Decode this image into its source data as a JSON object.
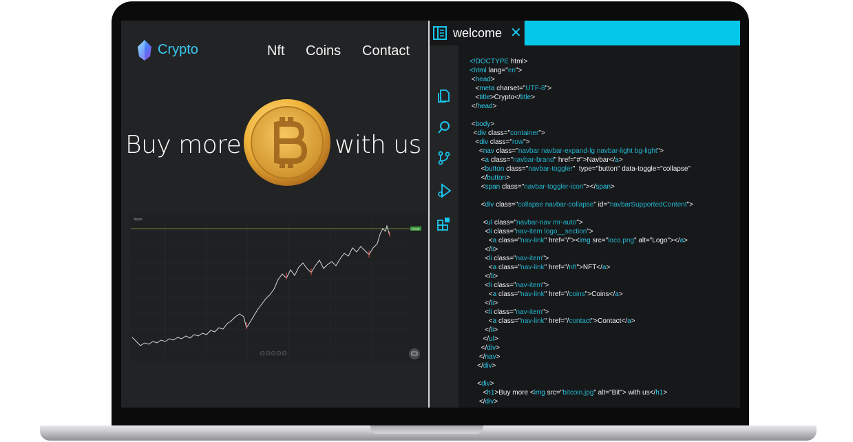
{
  "website": {
    "brand": "Crypto",
    "nav": [
      "Nft",
      "Coins",
      "Contact"
    ],
    "hero_left": "Buy more",
    "hero_right": "with us",
    "stock_chart": {
      "ticker_label": "Apple",
      "price_badge": "173.69",
      "icons": [
        "search-icon",
        "zoom-out-icon",
        "reset-icon",
        "zoom-in-icon",
        "pan-icon",
        "chat-icon"
      ]
    }
  },
  "editor": {
    "tab_title": "welcome",
    "tab_close": "✕",
    "activity_icons": [
      "files-icon",
      "search-icon",
      "source-control-icon",
      "run-debug-icon",
      "extensions-icon"
    ],
    "code_lines": [
      [
        {
          "t": "<",
          "c": "c"
        },
        {
          "t": "!DOCTYPE",
          "c": "c"
        },
        {
          "t": " html>",
          "c": ""
        }
      ],
      [
        {
          "t": "<",
          "c": "c"
        },
        {
          "t": "html",
          "c": "c"
        },
        {
          "t": " lang=\"",
          "c": ""
        },
        {
          "t": "en",
          "c": "s"
        },
        {
          "t": "\">",
          "c": ""
        }
      ],
      [
        {
          "t": " <",
          "c": ""
        },
        {
          "t": "head",
          "c": "c"
        },
        {
          "t": ">",
          "c": ""
        }
      ],
      [
        {
          "t": "   <",
          "c": ""
        },
        {
          "t": "meta",
          "c": "c"
        },
        {
          "t": " charset=\"",
          "c": ""
        },
        {
          "t": "UTF-8",
          "c": "s"
        },
        {
          "t": "\">",
          "c": ""
        }
      ],
      [
        {
          "t": "   <",
          "c": ""
        },
        {
          "t": "title",
          "c": "c"
        },
        {
          "t": ">Crypto</",
          "c": ""
        },
        {
          "t": "title",
          "c": "c"
        },
        {
          "t": ">",
          "c": ""
        }
      ],
      [
        {
          "t": " </",
          "c": ""
        },
        {
          "t": "head",
          "c": "c"
        },
        {
          "t": ">",
          "c": ""
        }
      ],
      [
        {
          "t": "",
          "c": ""
        }
      ],
      [
        {
          "t": " <",
          "c": ""
        },
        {
          "t": "body",
          "c": "c"
        },
        {
          "t": ">",
          "c": ""
        }
      ],
      [
        {
          "t": "  <",
          "c": ""
        },
        {
          "t": "div",
          "c": "c"
        },
        {
          "t": " class=\"",
          "c": ""
        },
        {
          "t": "container",
          "c": "s"
        },
        {
          "t": "\">",
          "c": ""
        }
      ],
      [
        {
          "t": "   <",
          "c": ""
        },
        {
          "t": "div",
          "c": "c"
        },
        {
          "t": " class=\"",
          "c": ""
        },
        {
          "t": "row",
          "c": "s"
        },
        {
          "t": "\">",
          "c": ""
        }
      ],
      [
        {
          "t": "     <",
          "c": ""
        },
        {
          "t": "nav",
          "c": "c"
        },
        {
          "t": " class=\"",
          "c": ""
        },
        {
          "t": "navbar navbar-expand-lg navbar-light bg-light",
          "c": "s"
        },
        {
          "t": "\">",
          "c": ""
        }
      ],
      [
        {
          "t": "      <",
          "c": ""
        },
        {
          "t": "a",
          "c": "c"
        },
        {
          "t": " class=\"",
          "c": ""
        },
        {
          "t": "navbar-brand",
          "c": "s"
        },
        {
          "t": "\" href=\"#\">Navbar</",
          "c": ""
        },
        {
          "t": "a",
          "c": "c"
        },
        {
          "t": ">",
          "c": ""
        }
      ],
      [
        {
          "t": "      <",
          "c": ""
        },
        {
          "t": "button",
          "c": "c"
        },
        {
          "t": " class=\"",
          "c": ""
        },
        {
          "t": "navbar-toggler",
          "c": "s"
        },
        {
          "t": "\"  type=\"button\" data-toggle=\"collapse\"",
          "c": ""
        }
      ],
      [
        {
          "t": "      </",
          "c": ""
        },
        {
          "t": "button",
          "c": "c"
        },
        {
          "t": ">",
          "c": ""
        }
      ],
      [
        {
          "t": "      <",
          "c": ""
        },
        {
          "t": "span",
          "c": "c"
        },
        {
          "t": " class=\"",
          "c": ""
        },
        {
          "t": "navbar-toggler-icon",
          "c": "s"
        },
        {
          "t": "\"></",
          "c": ""
        },
        {
          "t": "span",
          "c": "c"
        },
        {
          "t": ">",
          "c": ""
        }
      ],
      [
        {
          "t": "",
          "c": ""
        }
      ],
      [
        {
          "t": "      <",
          "c": ""
        },
        {
          "t": "div",
          "c": "c"
        },
        {
          "t": " class=\"",
          "c": ""
        },
        {
          "t": "collapse navbar-collapse",
          "c": "s"
        },
        {
          "t": "\" id=\"",
          "c": ""
        },
        {
          "t": "navbarSupportedContent",
          "c": "s"
        },
        {
          "t": "\">",
          "c": ""
        }
      ],
      [
        {
          "t": "",
          "c": ""
        }
      ],
      [
        {
          "t": "       <",
          "c": ""
        },
        {
          "t": "ul",
          "c": "c"
        },
        {
          "t": " class=\"",
          "c": ""
        },
        {
          "t": "navbar-nav mr-auto",
          "c": "s"
        },
        {
          "t": "\">",
          "c": ""
        }
      ],
      [
        {
          "t": "        <",
          "c": ""
        },
        {
          "t": "li",
          "c": "c"
        },
        {
          "t": " class=\"",
          "c": ""
        },
        {
          "t": "nav-item logo__section",
          "c": "s"
        },
        {
          "t": "\">",
          "c": ""
        }
      ],
      [
        {
          "t": "          <",
          "c": ""
        },
        {
          "t": "a",
          "c": "c"
        },
        {
          "t": " class=\"",
          "c": ""
        },
        {
          "t": "nav-link",
          "c": "s"
        },
        {
          "t": "\" href=\"/\"><",
          "c": ""
        },
        {
          "t": "img",
          "c": "c"
        },
        {
          "t": " src=\"",
          "c": ""
        },
        {
          "t": "loco.png",
          "c": "s"
        },
        {
          "t": "\" alt=\"Logo\"></",
          "c": ""
        },
        {
          "t": "a",
          "c": "c"
        },
        {
          "t": ">",
          "c": ""
        }
      ],
      [
        {
          "t": "        </",
          "c": ""
        },
        {
          "t": "li",
          "c": "c"
        },
        {
          "t": ">",
          "c": ""
        }
      ],
      [
        {
          "t": "        <",
          "c": ""
        },
        {
          "t": "li",
          "c": "c"
        },
        {
          "t": " class=\"",
          "c": ""
        },
        {
          "t": "nav-item",
          "c": "s"
        },
        {
          "t": "\">",
          "c": ""
        }
      ],
      [
        {
          "t": "          <",
          "c": ""
        },
        {
          "t": "a",
          "c": "c"
        },
        {
          "t": " class=\"",
          "c": ""
        },
        {
          "t": "nav-link",
          "c": "s"
        },
        {
          "t": "\" href=\"/",
          "c": ""
        },
        {
          "t": "nft",
          "c": "s"
        },
        {
          "t": "\">NFT</",
          "c": ""
        },
        {
          "t": "a",
          "c": "c"
        },
        {
          "t": ">",
          "c": ""
        }
      ],
      [
        {
          "t": "        </",
          "c": ""
        },
        {
          "t": "li",
          "c": "c"
        },
        {
          "t": ">",
          "c": ""
        }
      ],
      [
        {
          "t": "        <",
          "c": ""
        },
        {
          "t": "li",
          "c": "c"
        },
        {
          "t": " class=\"",
          "c": ""
        },
        {
          "t": "nav-item",
          "c": "s"
        },
        {
          "t": "\">",
          "c": ""
        }
      ],
      [
        {
          "t": "          <",
          "c": ""
        },
        {
          "t": "a",
          "c": "c"
        },
        {
          "t": " class=\"",
          "c": ""
        },
        {
          "t": "nav-link",
          "c": "s"
        },
        {
          "t": "\" href=\"/",
          "c": ""
        },
        {
          "t": "coins",
          "c": "s"
        },
        {
          "t": "\">Coins</",
          "c": ""
        },
        {
          "t": "a",
          "c": "c"
        },
        {
          "t": ">",
          "c": ""
        }
      ],
      [
        {
          "t": "        </",
          "c": ""
        },
        {
          "t": "li",
          "c": "c"
        },
        {
          "t": ">",
          "c": ""
        }
      ],
      [
        {
          "t": "        <",
          "c": ""
        },
        {
          "t": "li",
          "c": "c"
        },
        {
          "t": " class=\"",
          "c": ""
        },
        {
          "t": "nav-item",
          "c": "s"
        },
        {
          "t": "\">",
          "c": ""
        }
      ],
      [
        {
          "t": "          <",
          "c": ""
        },
        {
          "t": "a",
          "c": "c"
        },
        {
          "t": " class=\"",
          "c": ""
        },
        {
          "t": "nav-link",
          "c": "s"
        },
        {
          "t": "\" href=\"/",
          "c": ""
        },
        {
          "t": "contact",
          "c": "s"
        },
        {
          "t": "\">Contact</",
          "c": ""
        },
        {
          "t": "a",
          "c": "c"
        },
        {
          "t": ">",
          "c": ""
        }
      ],
      [
        {
          "t": "        </",
          "c": ""
        },
        {
          "t": "li",
          "c": "c"
        },
        {
          "t": ">",
          "c": ""
        }
      ],
      [
        {
          "t": "       </",
          "c": ""
        },
        {
          "t": "ul",
          "c": "c"
        },
        {
          "t": ">",
          "c": ""
        }
      ],
      [
        {
          "t": "      </",
          "c": ""
        },
        {
          "t": "div",
          "c": "c"
        },
        {
          "t": ">",
          "c": ""
        }
      ],
      [
        {
          "t": "     </",
          "c": ""
        },
        {
          "t": "nav",
          "c": "c"
        },
        {
          "t": ">",
          "c": ""
        }
      ],
      [
        {
          "t": "    </",
          "c": ""
        },
        {
          "t": "div",
          "c": "c"
        },
        {
          "t": ">",
          "c": ""
        }
      ],
      [
        {
          "t": "",
          "c": ""
        }
      ],
      [
        {
          "t": "    <",
          "c": ""
        },
        {
          "t": "div",
          "c": "c"
        },
        {
          "t": ">",
          "c": ""
        }
      ],
      [
        {
          "t": "       <",
          "c": ""
        },
        {
          "t": "h1",
          "c": "c"
        },
        {
          "t": ">Buy more <",
          "c": ""
        },
        {
          "t": "img",
          "c": "c"
        },
        {
          "t": " src=\"",
          "c": ""
        },
        {
          "t": "bitcoin.jpg",
          "c": "s"
        },
        {
          "t": "\" alt=\"Bit\"> with us</",
          "c": ""
        },
        {
          "t": "h1",
          "c": "c"
        },
        {
          "t": ">",
          "c": ""
        }
      ],
      [
        {
          "t": "     </",
          "c": ""
        },
        {
          "t": "div",
          "c": "c"
        },
        {
          "t": ">",
          "c": ""
        }
      ]
    ]
  },
  "colors": {
    "accent_cyan": "#05c8e9",
    "screen_bg": "#222325",
    "editor_bg": "#17181a",
    "coin_gold": "#f0b43a"
  }
}
